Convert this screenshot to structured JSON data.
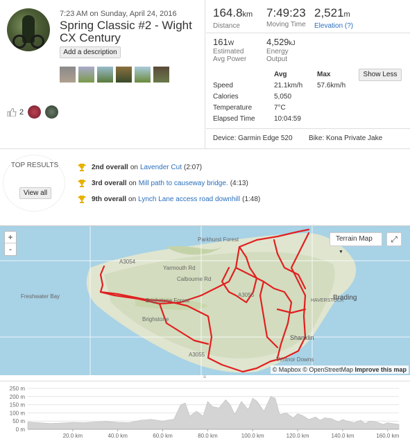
{
  "activity": {
    "datetime": "7:23 AM on Sunday, April 24, 2016",
    "title": "Spring Classic #2 - Wight CX Century",
    "add_description": "Add a description",
    "photo_count": 6,
    "kudos_count": "2"
  },
  "bigstats": [
    {
      "value": "164.8",
      "unit": "km",
      "label": "Distance"
    },
    {
      "value": "7:49:23",
      "unit": "",
      "label": "Moving Time"
    },
    {
      "value": "2,521",
      "unit": "m",
      "label": "Elevation (?)"
    }
  ],
  "midstats": [
    {
      "value": "161",
      "unit": "W",
      "label1": "Estimated",
      "label2": "Avg Power"
    },
    {
      "value": "4,529",
      "unit": "kJ",
      "label1": "Energy",
      "label2": "Output"
    }
  ],
  "show_less": "Show Less",
  "stats_table": {
    "headers": [
      "",
      "Avg",
      "Max"
    ],
    "rows": [
      [
        "Speed",
        "21.1km/h",
        "57.6km/h"
      ],
      [
        "Calories",
        "5,050",
        ""
      ],
      [
        "Temperature",
        "7°C",
        ""
      ],
      [
        "Elapsed Time",
        "10:04:59",
        ""
      ]
    ]
  },
  "device": "Device: Garmin Edge 520",
  "bike": "Bike: Kona Private Jake",
  "results": {
    "heading": "TOP RESULTS",
    "view_all": "View all",
    "items": [
      {
        "rank": "2nd overall",
        "on": "on",
        "segment": "Lavender Cut",
        "time": "(2:07)"
      },
      {
        "rank": "3rd overall",
        "on": "on",
        "segment": "Mill path to causeway bridge.",
        "time": "(4:13)"
      },
      {
        "rank": "9th overall",
        "on": "on",
        "segment": "Lynch Lane access road downhill",
        "time": "(1:48)"
      }
    ]
  },
  "map": {
    "zoom_in": "+",
    "zoom_out": "-",
    "terrain": "Terrain Map",
    "attribution_mapbox": "© Mapbox",
    "attribution_osm": "© OpenStreetMap",
    "improve": "Improve this map",
    "labels": [
      "Parkhurst Forest",
      "Yarmouth Rd",
      "A3054",
      "Calbourne Rd",
      "Freshwater Bay",
      "Brighstone Forest",
      "Brighstone",
      "A3055",
      "A3056",
      "Brading",
      "Shanklin",
      "Ventnor Downs",
      "HAVERSTOCK"
    ]
  },
  "elevation": {
    "y_ticks": [
      "250 m",
      "200 m",
      "150 m",
      "100 m",
      "50 m",
      "0 m"
    ],
    "x_ticks": [
      "20.0 km",
      "40.0 km",
      "60.0 km",
      "80.0 km",
      "100.0 km",
      "120.0 km",
      "140.0 km",
      "160.0 km"
    ]
  },
  "chart_data": {
    "type": "area",
    "xlabel": "",
    "ylabel": "",
    "xlim": [
      0,
      165
    ],
    "ylim": [
      0,
      250
    ],
    "x": [
      0,
      5,
      10,
      15,
      20,
      25,
      30,
      35,
      40,
      45,
      50,
      55,
      60,
      65,
      68,
      70,
      72,
      75,
      78,
      80,
      82,
      85,
      88,
      90,
      92,
      95,
      98,
      100,
      102,
      105,
      108,
      110,
      112,
      115,
      118,
      120,
      122,
      125,
      128,
      130,
      132,
      135,
      138,
      140,
      142,
      145,
      148,
      150,
      152,
      155,
      158,
      160,
      162,
      165
    ],
    "series": [
      {
        "values": [
          45,
          40,
          35,
          38,
          42,
          40,
          45,
          48,
          42,
          40,
          55,
          60,
          50,
          62,
          150,
          160,
          80,
          110,
          80,
          170,
          140,
          130,
          180,
          150,
          90,
          170,
          120,
          190,
          170,
          110,
          200,
          190,
          90,
          100,
          70,
          95,
          85,
          60,
          75,
          55,
          70,
          65,
          45,
          60,
          50,
          40,
          55,
          35,
          50,
          45,
          30,
          40,
          35,
          30
        ]
      }
    ]
  }
}
